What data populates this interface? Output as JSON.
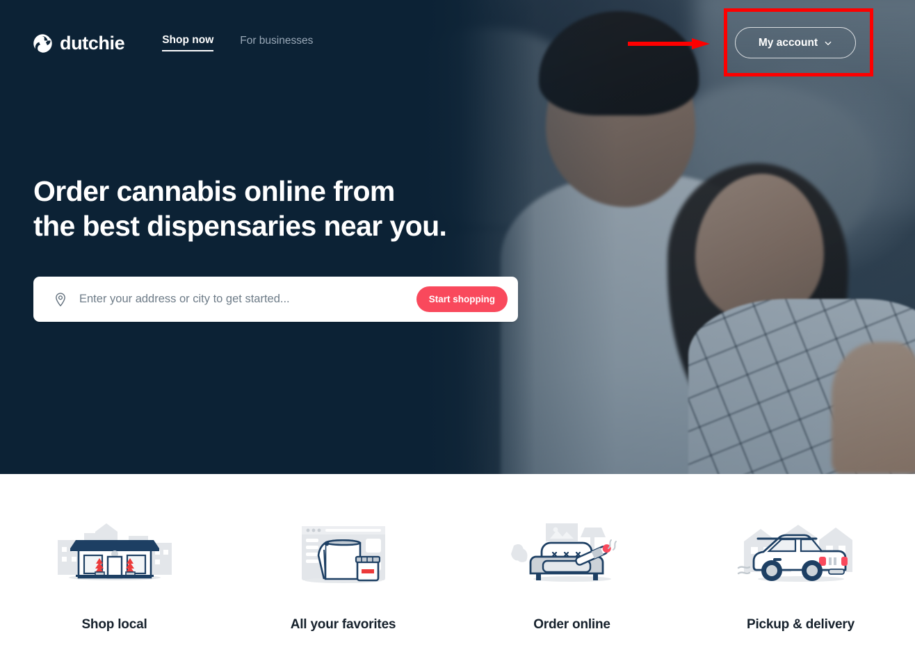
{
  "brand": {
    "name": "dutchie",
    "logo_icon": "dutchie-swirl-icon",
    "navy": "#0c2235",
    "accent_red": "#f9495c",
    "annotation_red": "#fe0000"
  },
  "nav": {
    "links": [
      {
        "label": "Shop now",
        "active": true
      },
      {
        "label": "For businesses",
        "active": false
      }
    ],
    "account": {
      "label": "My account",
      "chevron_icon": "chevron-down-icon"
    }
  },
  "hero": {
    "title_line1": "Order cannabis online from",
    "title_line2": "the best dispensaries near you.",
    "search": {
      "pin_icon": "location-pin-icon",
      "placeholder": "Enter your address or city to get started...",
      "value": "",
      "button_label": "Start shopping"
    }
  },
  "features": [
    {
      "label": "Shop local",
      "icon": "storefront-icon"
    },
    {
      "label": "All your favorites",
      "icon": "shopping-bag-browser-icon"
    },
    {
      "label": "Order online",
      "icon": "couch-joint-icon"
    },
    {
      "label": "Pickup & delivery",
      "icon": "delivery-car-icon"
    }
  ],
  "annotations": {
    "highlight_box": "my-account-highlight",
    "arrow": "pointer-arrow-right"
  }
}
